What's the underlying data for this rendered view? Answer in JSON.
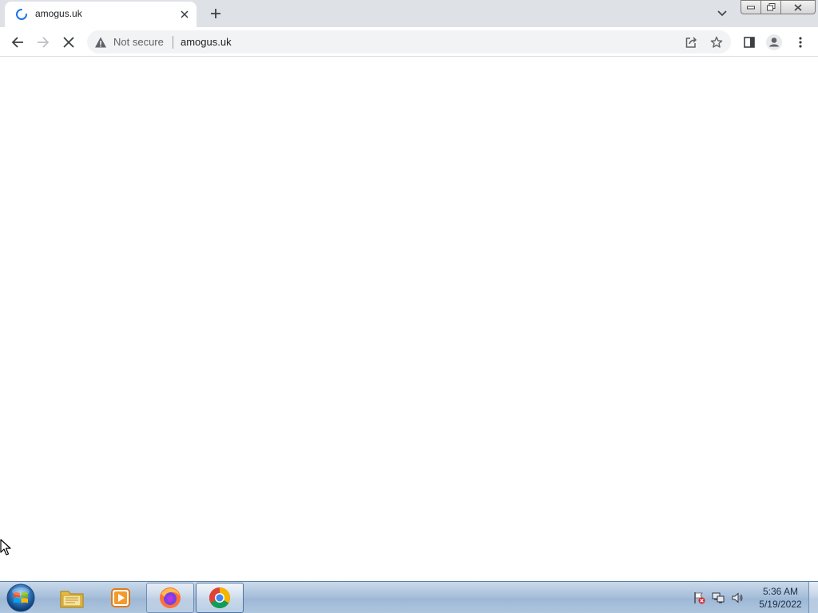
{
  "browser": {
    "tab": {
      "title": "amogus.uk"
    },
    "omnibox": {
      "security_label": "Not secure",
      "url": "amogus.uk"
    }
  },
  "taskbar": {
    "apps": [
      "windows-explorer",
      "windows-media-player",
      "firefox",
      "chrome"
    ],
    "active_app": "chrome",
    "clock": {
      "time": "5:36 AM",
      "date": "5/19/2022"
    }
  },
  "colors": {
    "tabstrip_bg": "#dee1e6",
    "omnibox_bg": "#f1f3f4",
    "spinner": "#1a73e8",
    "taskbar_bg": "#a9c1dc"
  }
}
